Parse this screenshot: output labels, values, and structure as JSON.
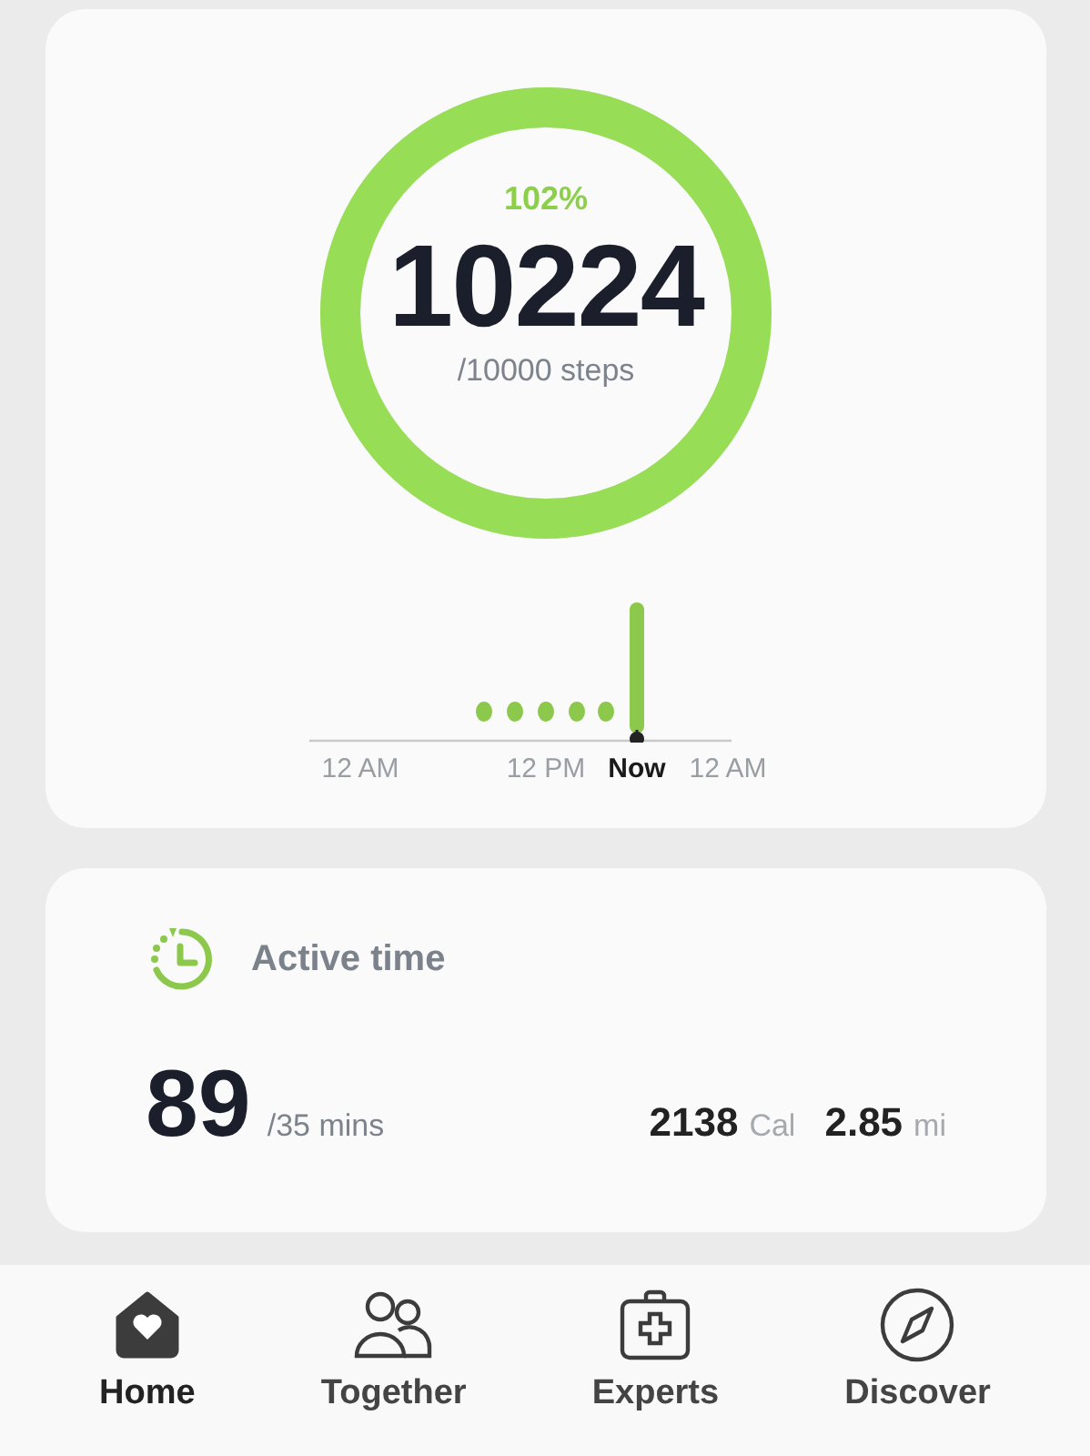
{
  "steps_card": {
    "percent": "102%",
    "count": "10224",
    "goal": "/10000 steps",
    "level": 1,
    "timeline_labels": [
      {
        "text": "12 AM",
        "kind": "tick"
      },
      {
        "text": "12 PM",
        "kind": "tick"
      },
      {
        "text": "Now",
        "kind": "now"
      },
      {
        "text": "12 AM",
        "kind": "tick"
      }
    ]
  },
  "active_card": {
    "title": "Active time",
    "minutes": "89",
    "goal": "/35 mins",
    "calories": "2138",
    "calories_unit": "Cal",
    "distance": "2.85",
    "distance_unit": "mi"
  },
  "nav": [
    {
      "label": "Home",
      "selected": true
    },
    {
      "label": "Together",
      "selected": false
    },
    {
      "label": "Experts",
      "selected": false
    },
    {
      "label": "Discover",
      "selected": false
    }
  ]
}
